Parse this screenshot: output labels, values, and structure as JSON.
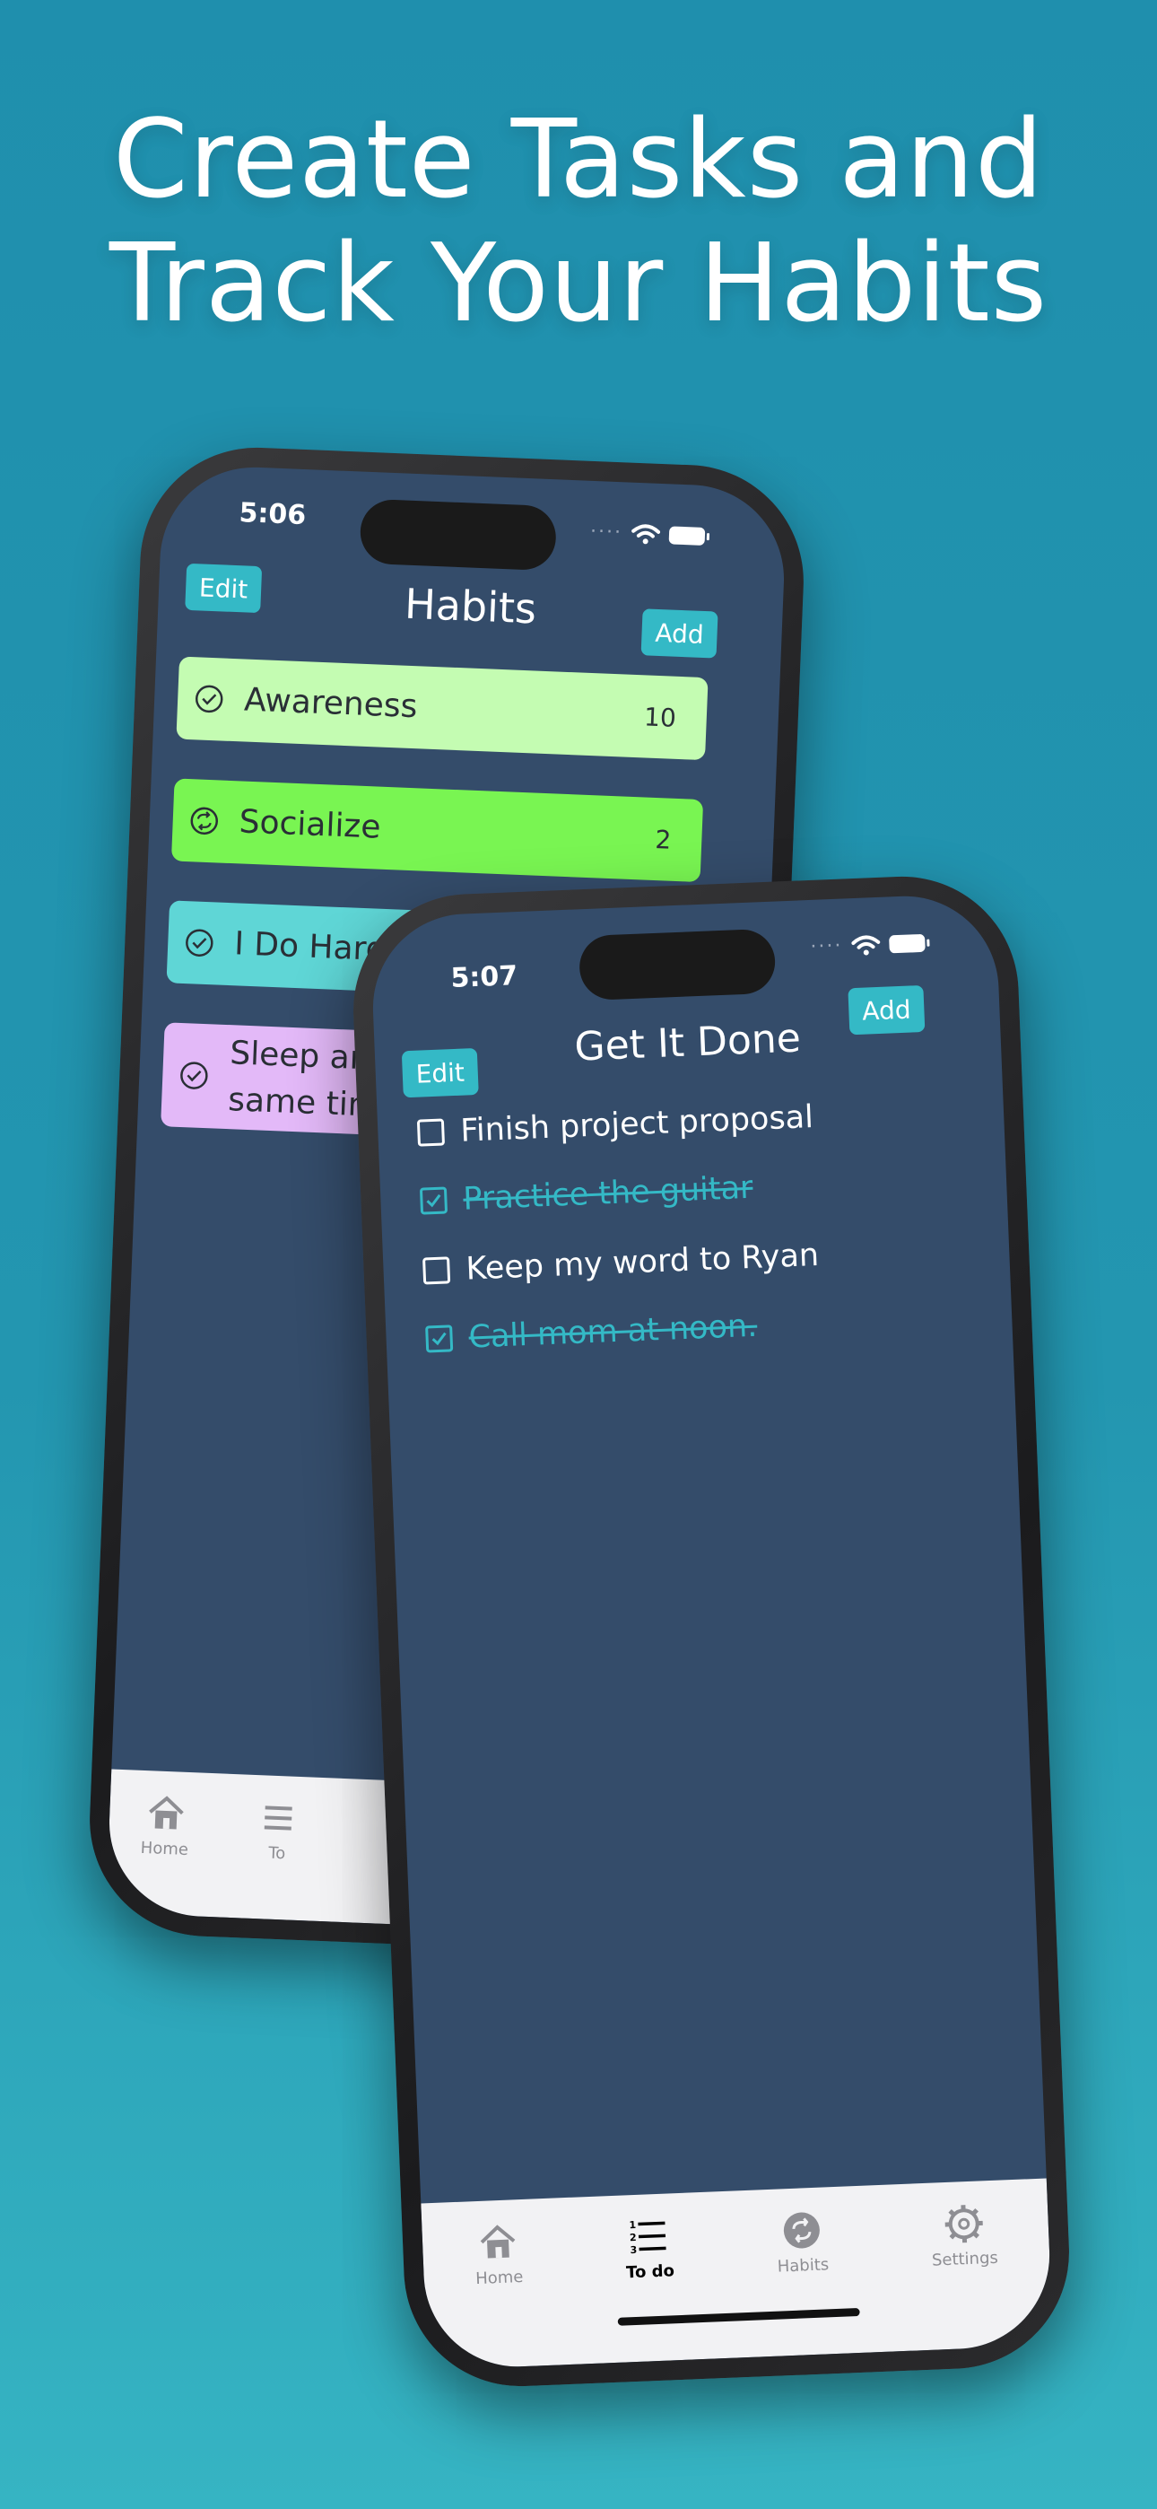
{
  "headline": {
    "line1": "Create Tasks and",
    "line2": "Track Your Habits"
  },
  "colors": {
    "accent": "#34b9c6",
    "screen_bg": "#344c6a"
  },
  "habits_screen": {
    "time": "5:06",
    "title": "Habits",
    "edit_label": "Edit",
    "add_label": "Add",
    "habits": [
      {
        "label": "Awareness",
        "count": "10",
        "color": "#c4fcb2",
        "icon": "check-circle-icon"
      },
      {
        "label": "Socialize",
        "count": "2",
        "color": "#79f552",
        "icon": "repeat-circle-icon"
      },
      {
        "label": "I Do Hard Th",
        "count": "",
        "color": "#5fd6d6",
        "icon": "check-circle-icon"
      },
      {
        "label": "Sleep ar",
        "label2": "same tin",
        "count": "",
        "color": "#e3b9f8",
        "icon": "check-circle-icon"
      }
    ],
    "tabs": {
      "home": "Home",
      "todo": "To"
    }
  },
  "todo_screen": {
    "time": "5:07",
    "title": "Get It Done",
    "edit_label": "Edit",
    "add_label": "Add",
    "items": [
      {
        "text": "Finish project proposal",
        "done": false
      },
      {
        "text": "Practice the guitar",
        "done": true
      },
      {
        "text": "Keep my word to Ryan",
        "done": false
      },
      {
        "text": "Call mom at noon.",
        "done": true
      }
    ],
    "tabs": {
      "home": "Home",
      "todo": "To do",
      "habits": "Habits",
      "settings": "Settings"
    }
  }
}
